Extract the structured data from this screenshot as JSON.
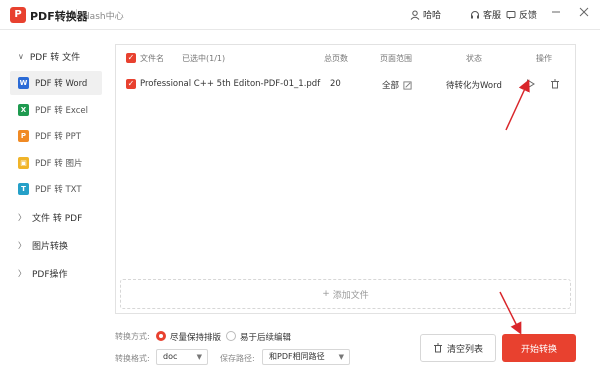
{
  "app": {
    "logo_letter": "P",
    "title": "PDF转换器",
    "subtitle": "Flash中心",
    "user": "哈哈",
    "support": "客服",
    "feedback": "反馈"
  },
  "sidebar": {
    "sections": [
      {
        "label": "PDF 转 文件",
        "chevron": "∨"
      },
      {
        "label": "文件 转 PDF",
        "chevron": "〉"
      },
      {
        "label": "图片转换",
        "chevron": "〉"
      },
      {
        "label": "PDF操作",
        "chevron": "〉"
      }
    ],
    "items": [
      {
        "label": "PDF 转 Word",
        "icon": "W",
        "color": "#2b6bd6"
      },
      {
        "label": "PDF 转 Excel",
        "icon": "X",
        "color": "#1e9a4f"
      },
      {
        "label": "PDF 转 PPT",
        "icon": "P",
        "color": "#f08a24"
      },
      {
        "label": "PDF 转 图片",
        "icon": "▣",
        "color": "#f0b429"
      },
      {
        "label": "PDF 转 TXT",
        "icon": "T",
        "color": "#25a0c8"
      }
    ]
  },
  "table": {
    "headers": {
      "filename": "文件名",
      "selected": "已选中(1/1)",
      "pages": "总页数",
      "range": "页面范围",
      "status": "状态",
      "action": "操作"
    },
    "rows": [
      {
        "filename": "Professional C++ 5th Editon-PDF-01_1.pdf",
        "pages": "20",
        "range": "全部",
        "status": "待转化为Word"
      }
    ],
    "add_file": "添加文件"
  },
  "options": {
    "mode_label": "转换方式:",
    "mode_options": [
      "尽量保持排版",
      "易于后续编辑"
    ],
    "format_label": "转换格式:",
    "format_value": "doc",
    "path_label": "保存路径:",
    "path_value": "和PDF相同路径"
  },
  "buttons": {
    "clear": "清空列表",
    "start": "开始转换"
  },
  "colors": {
    "accent": "#e8412f",
    "arrow": "#d9262b"
  }
}
